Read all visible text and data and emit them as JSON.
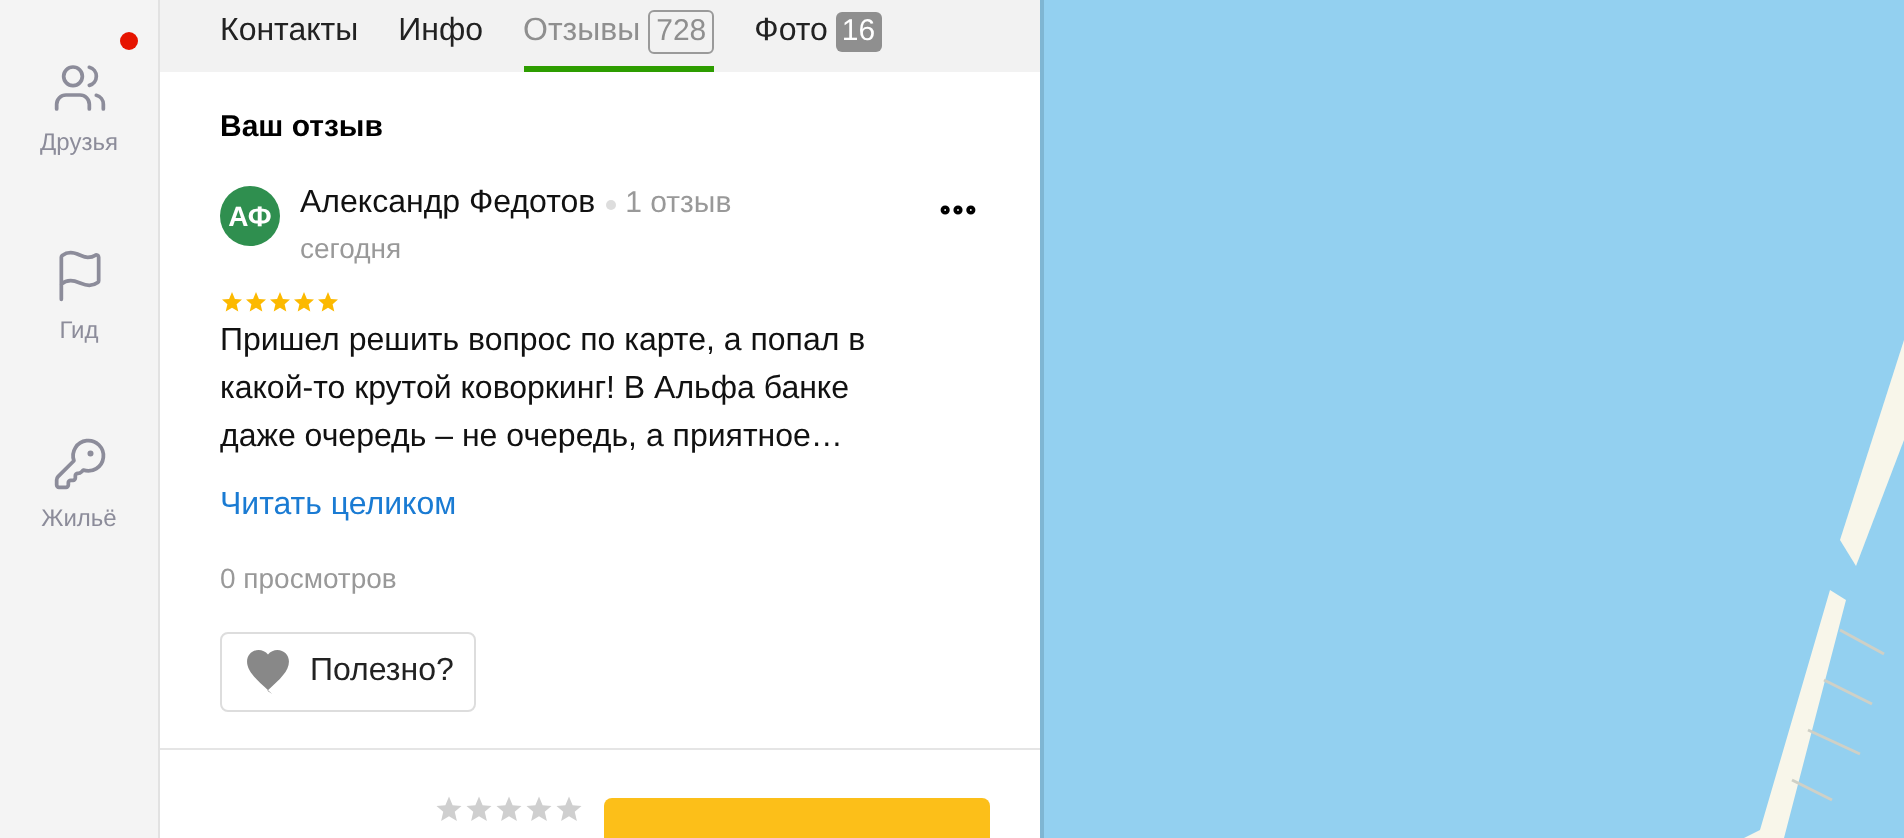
{
  "sidebar": {
    "items": [
      {
        "label": "Друзья",
        "kind": "friends",
        "badge": true
      },
      {
        "label": "Гид",
        "kind": "guide",
        "badge": false
      },
      {
        "label": "Жильё",
        "kind": "housing",
        "badge": false
      }
    ]
  },
  "tabs": [
    {
      "label": "Контакты",
      "selected": false
    },
    {
      "label": "Инфо",
      "selected": false
    },
    {
      "label": "Отзывы",
      "count": "728",
      "selected": true
    },
    {
      "label": "Фото",
      "count": "16",
      "selected": false
    }
  ],
  "my_review": {
    "heading": "Ваш отзыв",
    "initials": "АФ",
    "author": "Александр Федотов",
    "author_reviews": "1 отзыв",
    "date": "сегодня",
    "stars": 5,
    "text": "Пришел решить вопрос по карте, а попал в какой-то крутой коворкинг! В Альфа банке даже очередь – не очередь, а приятное…",
    "read_more": "Читать целиком",
    "views": "0 просмотров",
    "helpful": "Полезно?"
  },
  "rate_prompt": {
    "stars": 0
  }
}
